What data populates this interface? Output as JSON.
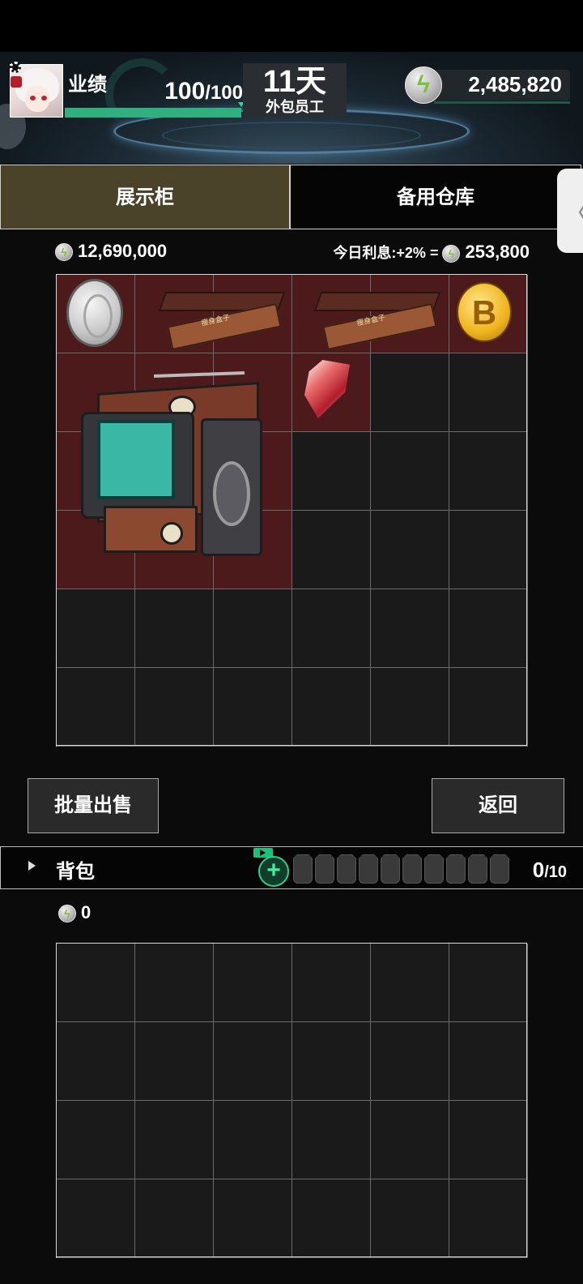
{
  "player": {
    "performance_label": "业绩",
    "performance_value": "100",
    "performance_max": "/100",
    "performance_progress": 1.0,
    "day_count": "11天",
    "role": "外包员工",
    "currency": "2,485,820"
  },
  "tabs": [
    {
      "label": "展示柜",
      "active": true
    },
    {
      "label": "备用仓库",
      "active": false
    }
  ],
  "cabinet": {
    "total": "12,690,000",
    "interest_label": "今日利息:+2% =",
    "interest_amount": "253,800",
    "grid_rows": 6,
    "grid_cols": 6,
    "items": [
      {
        "name": "silver-coin-icon"
      },
      {
        "name": "wooden-box-icon",
        "text": "瘦身盒子"
      },
      {
        "name": "wooden-box-icon",
        "text": "瘦身盒子"
      },
      {
        "name": "bitcoin-icon",
        "symbol": "B"
      },
      {
        "name": "retro-tv-icon"
      },
      {
        "name": "red-crystal-icon"
      }
    ]
  },
  "buttons": {
    "bulk_sell": "批量出售",
    "back": "返回"
  },
  "backpack": {
    "title": "背包",
    "count": "0",
    "capacity": "/10",
    "slot_count": 10,
    "money": "0",
    "grid_rows": 4,
    "grid_cols": 6
  },
  "colors": {
    "occupied_cell": "#4c1a1a",
    "empty_cell": "#1a1a1a",
    "active_tab": "#4a4229",
    "accent_green": "#2cd08a"
  }
}
